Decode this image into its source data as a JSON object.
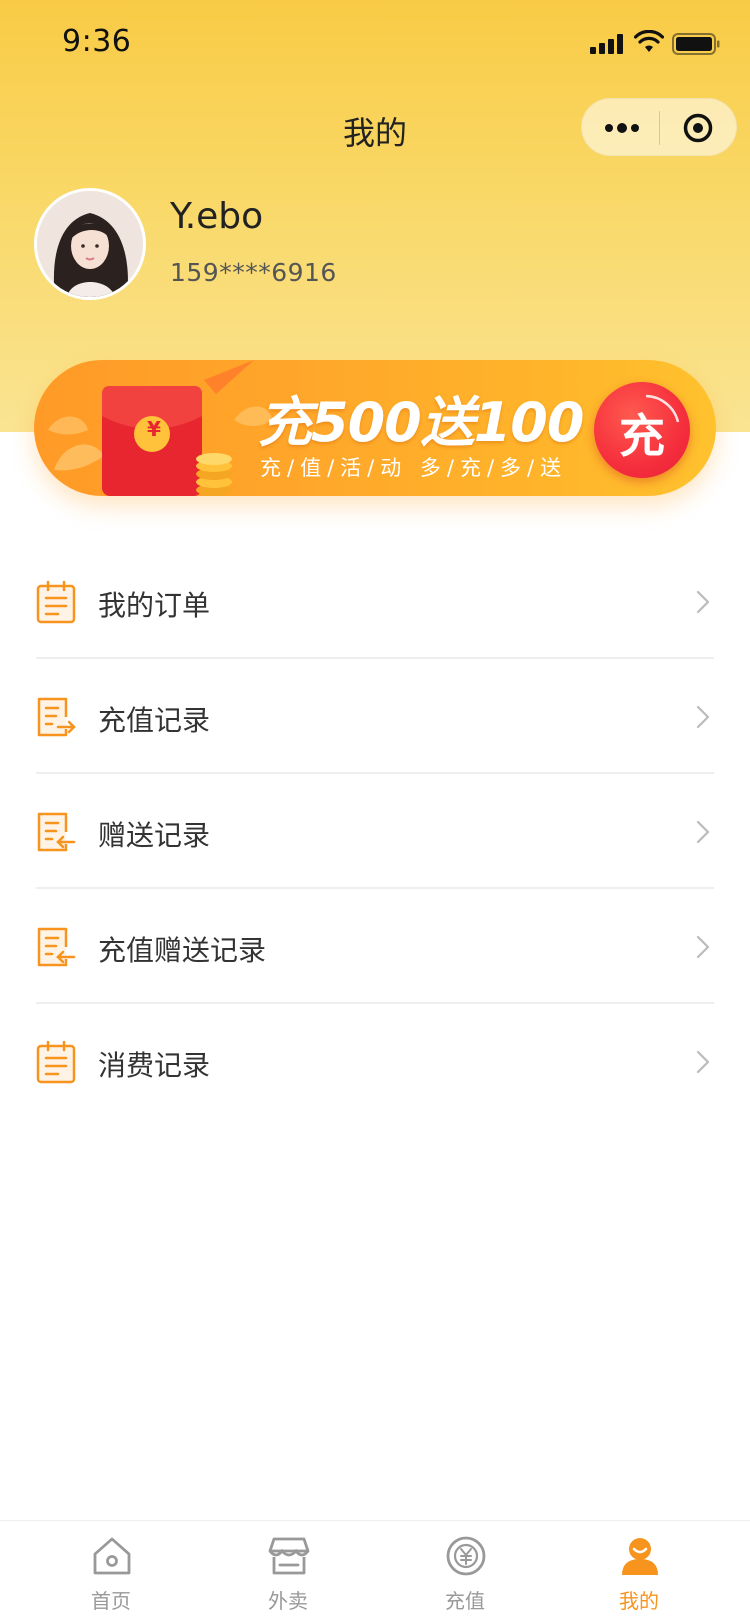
{
  "status_bar": {
    "time": "9:36"
  },
  "nav": {
    "title": "我的"
  },
  "profile": {
    "name": "Y.ebo",
    "phone": "159****6916"
  },
  "banner": {
    "headline": "充500送100",
    "subtitle": "充/值/活/动  多/充/多/送",
    "button_label": "充",
    "envelope_symbol": "¥"
  },
  "menu": {
    "items": [
      {
        "label": "我的订单",
        "icon": "order-list-icon"
      },
      {
        "label": "充值记录",
        "icon": "recharge-record-icon"
      },
      {
        "label": "赠送记录",
        "icon": "gift-record-icon"
      },
      {
        "label": "充值赠送记录",
        "icon": "recharge-gift-record-icon"
      },
      {
        "label": "消费记录",
        "icon": "consumption-record-icon"
      }
    ]
  },
  "tabbar": {
    "tabs": [
      {
        "label": "首页",
        "icon": "home-icon"
      },
      {
        "label": "外卖",
        "icon": "store-icon"
      },
      {
        "label": "充值",
        "icon": "yuan-coin-icon"
      },
      {
        "label": "我的",
        "icon": "user-icon"
      }
    ],
    "active_index": 3
  },
  "colors": {
    "accent": "#f7941d",
    "header": "#f9cb45",
    "banner_button": "#f52f3c"
  }
}
